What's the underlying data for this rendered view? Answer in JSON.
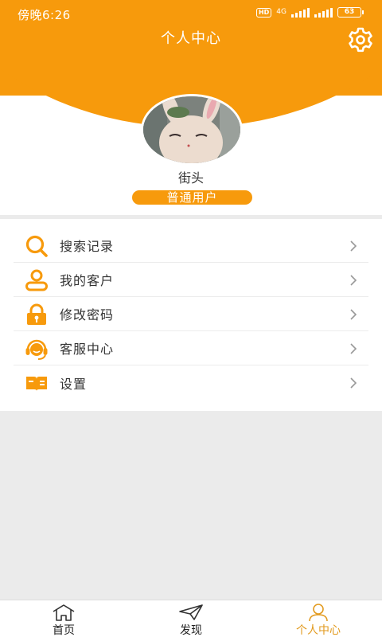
{
  "status_bar": {
    "time": "傍晚6:26",
    "hd": "HD",
    "network": "4G",
    "battery": "63"
  },
  "header": {
    "title": "个人中心"
  },
  "profile": {
    "username": "街头",
    "role": "普通用户"
  },
  "menu": [
    {
      "label": "搜索记录",
      "icon": "search-icon"
    },
    {
      "label": "我的客户",
      "icon": "user-icon"
    },
    {
      "label": "修改密码",
      "icon": "lock-icon"
    },
    {
      "label": "客服中心",
      "icon": "headset-icon"
    },
    {
      "label": "设置",
      "icon": "book-icon"
    }
  ],
  "tabbar": [
    {
      "label": "首页",
      "icon": "home-icon",
      "active": false
    },
    {
      "label": "发现",
      "icon": "paper-plane-icon",
      "active": false
    },
    {
      "label": "个人中心",
      "icon": "person-icon",
      "active": true
    }
  ],
  "colors": {
    "accent": "#f79a0c",
    "tab_active": "#e29a1e",
    "background": "#ebebeb"
  }
}
